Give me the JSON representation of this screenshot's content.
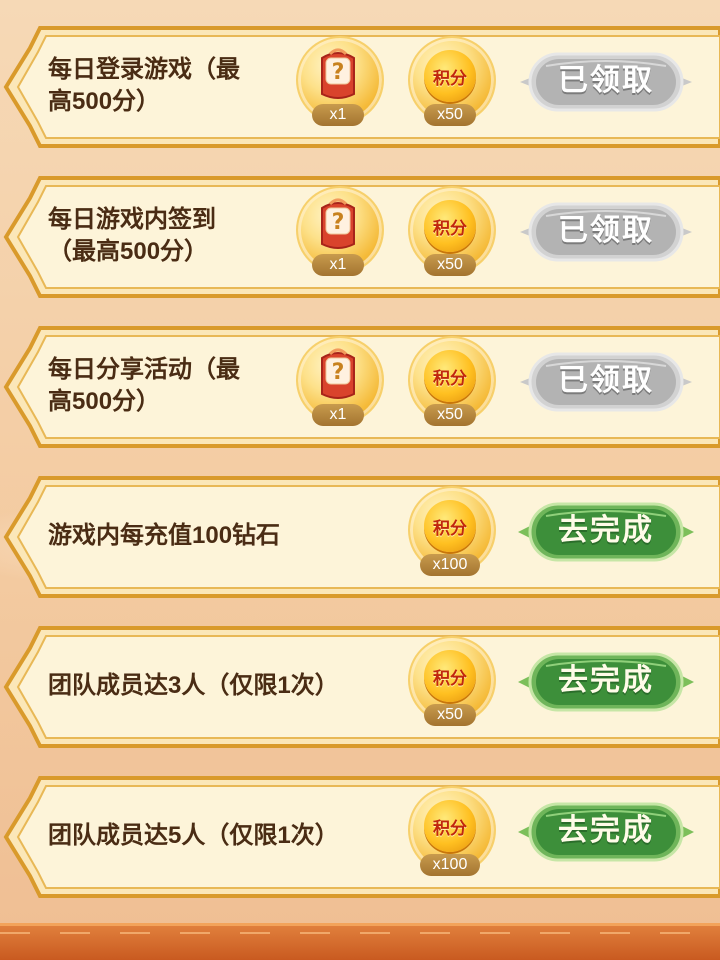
{
  "tasks": [
    {
      "title": "每日登录游戏（最\n高500分）",
      "rewards": [
        {
          "type": "mystery-box",
          "icon": "mystery-box-icon",
          "qty": "x1"
        },
        {
          "type": "points",
          "icon": "points-coin-icon",
          "coin_text": "积分",
          "qty": "x50"
        }
      ],
      "button": {
        "label": "已领取",
        "state": "claimed"
      }
    },
    {
      "title": "每日游戏内签到\n（最高500分）",
      "rewards": [
        {
          "type": "mystery-box",
          "icon": "mystery-box-icon",
          "qty": "x1"
        },
        {
          "type": "points",
          "icon": "points-coin-icon",
          "coin_text": "积分",
          "qty": "x50"
        }
      ],
      "button": {
        "label": "已领取",
        "state": "claimed"
      }
    },
    {
      "title": "每日分享活动（最\n高500分）",
      "rewards": [
        {
          "type": "mystery-box",
          "icon": "mystery-box-icon",
          "qty": "x1"
        },
        {
          "type": "points",
          "icon": "points-coin-icon",
          "coin_text": "积分",
          "qty": "x50"
        }
      ],
      "button": {
        "label": "已领取",
        "state": "claimed"
      }
    },
    {
      "title": "游戏内每充值100钻石",
      "rewards": [
        {
          "type": "points",
          "icon": "points-coin-icon",
          "coin_text": "积分",
          "qty": "x100"
        }
      ],
      "button": {
        "label": "去完成",
        "state": "available"
      }
    },
    {
      "title": "团队成员达3人（仅限1次）",
      "rewards": [
        {
          "type": "points",
          "icon": "points-coin-icon",
          "coin_text": "积分",
          "qty": "x50"
        }
      ],
      "button": {
        "label": "去完成",
        "state": "available"
      }
    },
    {
      "title": "团队成员达5人（仅限1次）",
      "rewards": [
        {
          "type": "points",
          "icon": "points-coin-icon",
          "coin_text": "积分",
          "qty": "x100"
        }
      ],
      "button": {
        "label": "去完成",
        "state": "available"
      }
    }
  ],
  "colors": {
    "card_fill": "#fdf2d2",
    "card_border": "#d99a2b",
    "title_text": "#4a2c14",
    "claimed_button": "#b9b9b9",
    "go_button": "#3f9a3f",
    "coin_text": "#c0270e"
  }
}
